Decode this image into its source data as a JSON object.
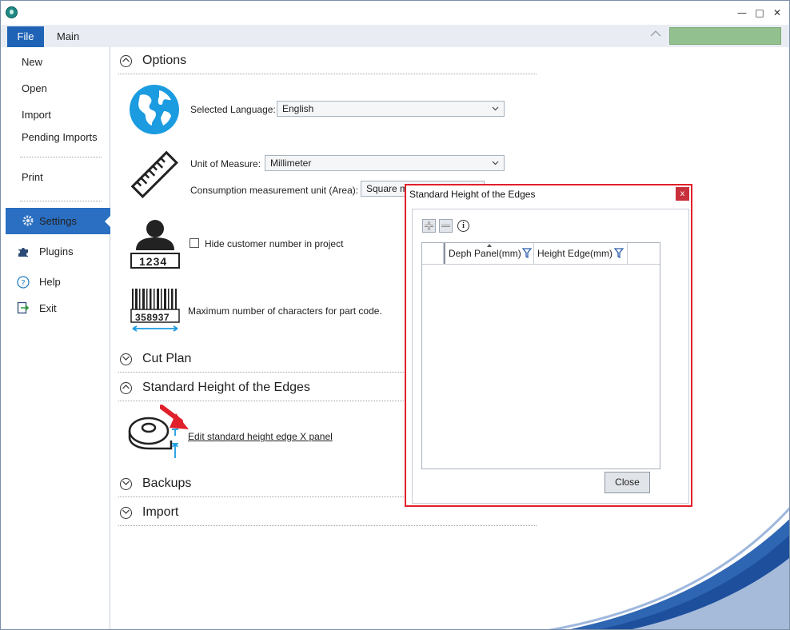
{
  "titlebar": {
    "minimize": "—",
    "maximize": "□",
    "close": "✕"
  },
  "tabs": {
    "file": "File",
    "main": "Main"
  },
  "sidebar": {
    "new": "New",
    "open": "Open",
    "import": "Import",
    "pending_imports": "Pending Imports",
    "print": "Print",
    "settings": "Settings",
    "plugins": "Plugins",
    "help": "Help",
    "exit": "Exit"
  },
  "sections": {
    "options": "Options",
    "cut_plan": "Cut Plan",
    "standard_height": "Standard Height of the Edges",
    "backups": "Backups",
    "import": "Import"
  },
  "options": {
    "language_label": "Selected Language:",
    "language_value": "English",
    "unit_label": "Unit of Measure:",
    "unit_value": "Millimeter",
    "consumption_label": "Consumption measurement unit (Area):",
    "consumption_value": "Square m",
    "customer_number_icon_text": "1234",
    "hide_customer_label": "Hide customer number in project",
    "barcode_number": "358937",
    "max_chars_label": "Maximum number of characters for part code."
  },
  "edges": {
    "edit_link": "Edit standard height edge X panel"
  },
  "dialog": {
    "title": "Standard Height of the Edges",
    "close_x": "x",
    "add": "+",
    "remove": "−",
    "info": "i",
    "col_deph": "Deph Panel(mm)",
    "col_height": "Height Edge(mm)",
    "close_button": "Close"
  },
  "colors": {
    "accent_blue": "#2a6fc2",
    "file_tab": "#1f63b6",
    "annotation_red": "#e0202a",
    "status_green": "#93c08f"
  }
}
